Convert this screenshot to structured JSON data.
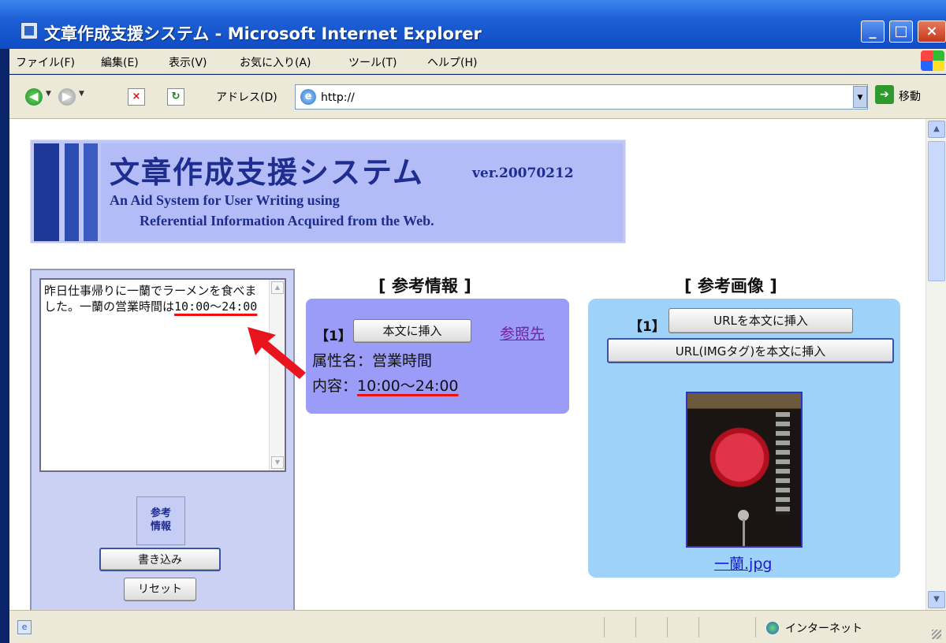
{
  "window": {
    "title": "文章作成支援システム - Microsoft Internet Explorer",
    "minimize": "_",
    "maximize": "□",
    "close": "×"
  },
  "menubar": {
    "items": [
      "ファイル(F)",
      "編集(E)",
      "表示(V)",
      "お気に入り(A)",
      "ツール(T)",
      "ヘルプ(H)"
    ]
  },
  "toolbar": {
    "address_label": "アドレス(D)",
    "url": "http://",
    "go_label": "移動"
  },
  "page": {
    "header": {
      "jp_title": "文章作成支援システム",
      "version": "ver.20070212",
      "en_line1": "An Aid System for User Writing using",
      "en_line2": "Referential Information Acquired from the Web."
    },
    "editor": {
      "text_part1": "昨日仕事帰りに一蘭でラーメンを食べました。一蘭の営業時間は",
      "text_highlight": "10:00～24:00",
      "ref_info_button": "参考\n情報",
      "write_button": "書き込み",
      "reset_button": "リセット"
    },
    "reference_info": {
      "title": "[ 参考情報 ]",
      "index": "【1】",
      "insert_button": "本文に挿入",
      "source_link": "参照先",
      "attribute": "属性名：営業時間",
      "content_label": "内容：",
      "content_value": "10:00〜24:00"
    },
    "reference_image": {
      "title": "[ 参考画像 ]",
      "index": "【1】",
      "url_button": "URLを本文に挿入",
      "url_img_tag_button": "URL(IMGタグ)を本文に挿入",
      "caption": "一蘭.jpg"
    }
  },
  "statusbar": {
    "zone": "インターネット"
  },
  "colors": {
    "annotation": "#e8141e",
    "ref_box": "#9b9cf7",
    "img_box": "#9fd2f8",
    "banner": "#b3bcf6"
  }
}
